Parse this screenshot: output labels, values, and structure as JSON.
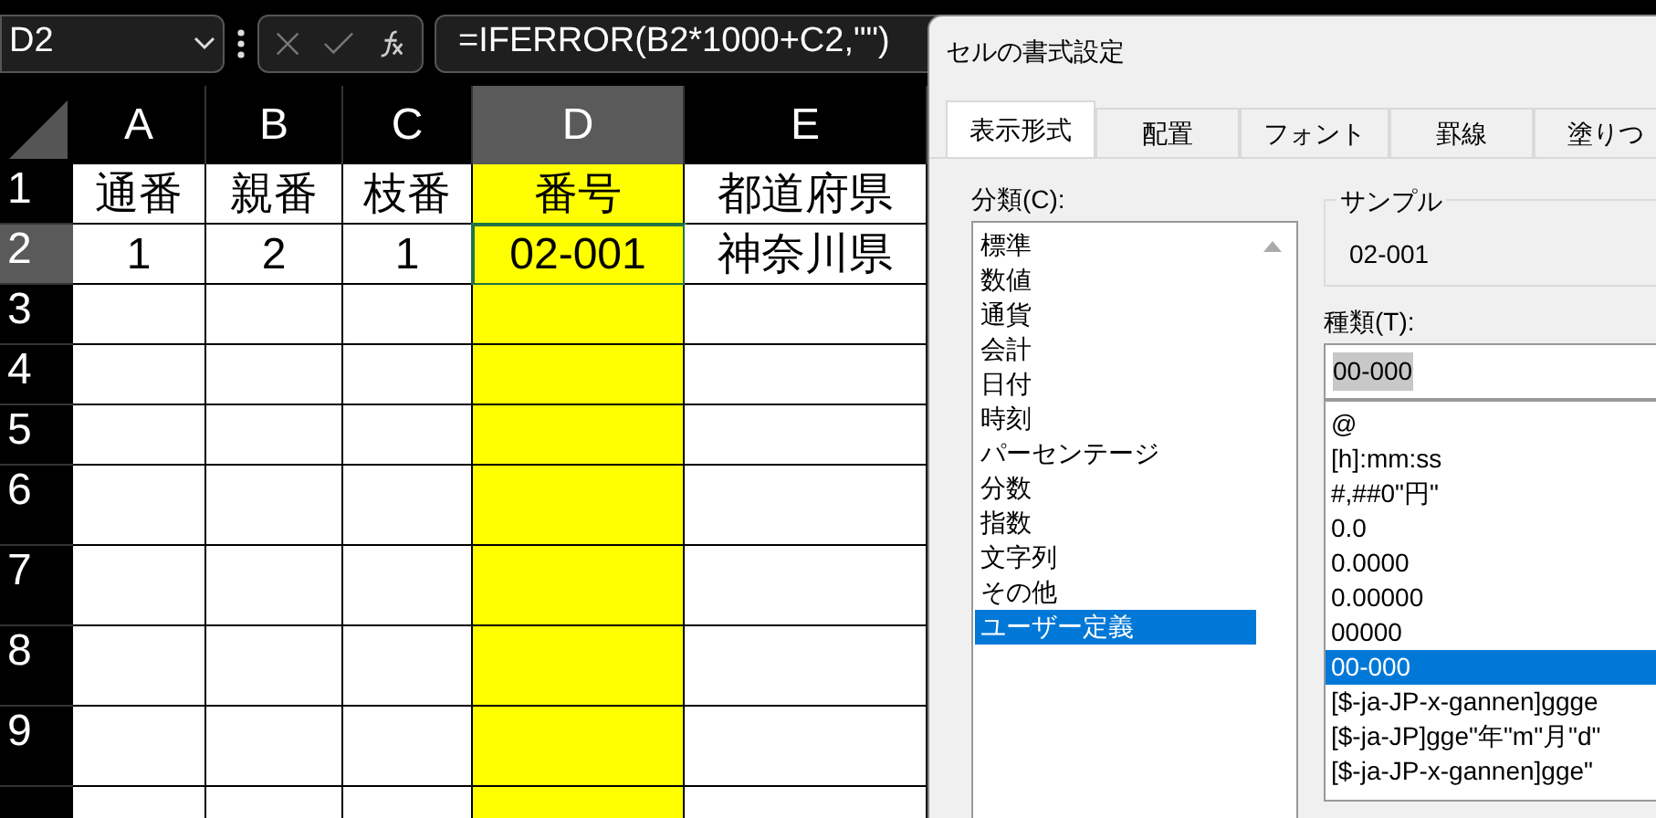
{
  "name_box": {
    "value": "D2"
  },
  "formula_bar": {
    "value": "=IFERROR(B2*1000+C2,\"\")"
  },
  "columns": [
    {
      "label": "A",
      "selected": false
    },
    {
      "label": "B",
      "selected": false
    },
    {
      "label": "C",
      "selected": false
    },
    {
      "label": "D",
      "selected": true,
      "color": "#ffff00"
    },
    {
      "label": "E",
      "selected": false
    }
  ],
  "rows": [
    {
      "label": "1",
      "selected": false,
      "cells": [
        "通番",
        "親番",
        "枝番",
        "番号",
        "都道府県"
      ]
    },
    {
      "label": "2",
      "selected": true,
      "cells": [
        "1",
        "2",
        "1",
        "02-001",
        "神奈川県"
      ]
    },
    {
      "label": "3",
      "selected": false
    },
    {
      "label": "4",
      "selected": false
    },
    {
      "label": "5",
      "selected": false
    },
    {
      "label": "6",
      "selected": false
    },
    {
      "label": "7",
      "selected": false
    },
    {
      "label": "8",
      "selected": false
    },
    {
      "label": "9",
      "selected": false
    }
  ],
  "dialog": {
    "title": "セルの書式設定",
    "tabs": [
      {
        "label": "表示形式",
        "selected": true
      },
      {
        "label": "配置",
        "selected": false
      },
      {
        "label": "フォント",
        "selected": false
      },
      {
        "label": "罫線",
        "selected": false
      },
      {
        "label": "塗りつ",
        "selected": false
      }
    ],
    "category_label": "分類(C):",
    "categories": [
      {
        "label": "標準",
        "selected": false
      },
      {
        "label": "数値",
        "selected": false
      },
      {
        "label": "通貨",
        "selected": false
      },
      {
        "label": "会計",
        "selected": false
      },
      {
        "label": "日付",
        "selected": false
      },
      {
        "label": "時刻",
        "selected": false
      },
      {
        "label": "パーセンテージ",
        "selected": false
      },
      {
        "label": "分数",
        "selected": false
      },
      {
        "label": "指数",
        "selected": false
      },
      {
        "label": "文字列",
        "selected": false
      },
      {
        "label": "その他",
        "selected": false
      },
      {
        "label": "ユーザー定義",
        "selected": true
      }
    ],
    "sample": {
      "legend": "サンプル",
      "value": "02-001"
    },
    "type_label": "種類(T):",
    "type_input": {
      "value": "00-000"
    },
    "types": [
      {
        "label": "@",
        "selected": false
      },
      {
        "label": "[h]:mm:ss",
        "selected": false
      },
      {
        "label": "#,##0\"円\"",
        "selected": false
      },
      {
        "label": "0.0",
        "selected": false
      },
      {
        "label": "0.0000",
        "selected": false
      },
      {
        "label": "0.00000",
        "selected": false
      },
      {
        "label": "00000",
        "selected": false
      },
      {
        "label": "00-000",
        "selected": true
      },
      {
        "label": "[$-ja-JP-x-gannen]ggge",
        "selected": false
      },
      {
        "label": "[$-ja-JP]gge\"年\"m\"月\"d\"",
        "selected": false
      },
      {
        "label": "[$-ja-JP-x-gannen]gge\"",
        "selected": false
      }
    ]
  }
}
